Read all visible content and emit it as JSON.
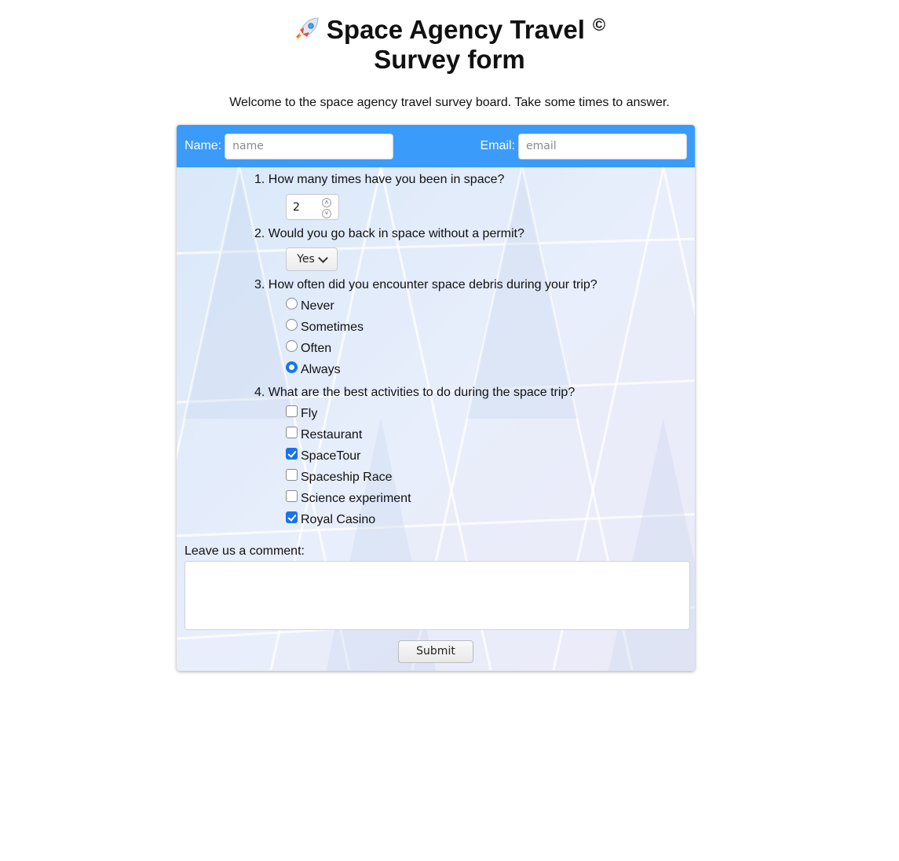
{
  "header": {
    "title": "Space Agency Travel",
    "copyright_mark": "©",
    "subtitle": "Survey form",
    "rocket_icon": "rocket-icon"
  },
  "welcome": "Welcome to the space agency travel survey board. Take some times to answer.",
  "form": {
    "name_label": "Name:",
    "name_placeholder": "name",
    "email_label": "Email:",
    "email_placeholder": "email",
    "accent_color": "#3a9bfb",
    "questions": [
      {
        "label": "1. How many times have you been in space?",
        "value": "2"
      },
      {
        "label": "2. Would you go back in space without a permit?",
        "selected": "Yes"
      },
      {
        "label": "3. How often did you encounter space debris during your trip?",
        "options": [
          "Never",
          "Sometimes",
          "Often",
          "Always"
        ],
        "selected": "Always"
      },
      {
        "label": "4. What are the best activities to do during the space trip?",
        "options": [
          "Fly",
          "Restaurant",
          "SpaceTour",
          "Spaceship Race",
          "Science experiment",
          "Royal Casino"
        ],
        "checked": [
          "SpaceTour",
          "Royal Casino"
        ]
      }
    ],
    "comment_label": "Leave us a comment:",
    "comment_value": "",
    "submit_label": "Submit"
  }
}
